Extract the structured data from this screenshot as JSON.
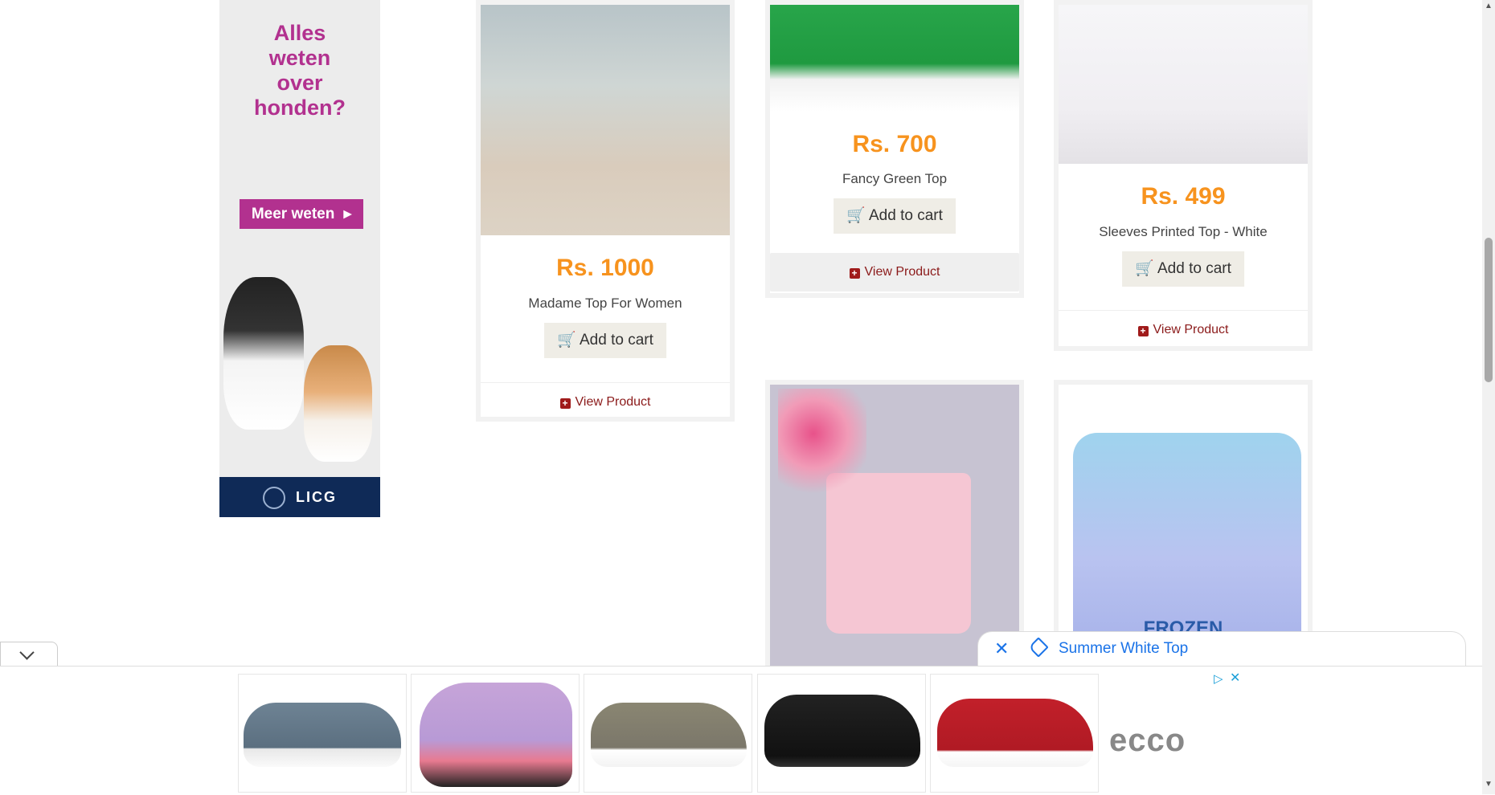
{
  "side_ad": {
    "headline_lines": [
      "Alles",
      "weten",
      "over",
      "honden?"
    ],
    "cta_label": "Meer weten",
    "brand": "LICG"
  },
  "products": [
    {
      "price": "Rs. 1000",
      "name": "Madame Top For Women",
      "cart_label": "Add to cart",
      "view_label": "View Product"
    },
    {
      "price": "Rs. 700",
      "name": "Fancy Green Top",
      "cart_label": "Add to cart",
      "view_label": "View Product"
    },
    {
      "price": "Rs. 499",
      "name": "Sleeves Printed Top - White",
      "cart_label": "Add to cart",
      "view_label": "View Product"
    }
  ],
  "frozen_shirt_text": "FROZEN",
  "search_chip": {
    "text": "Summer White Top"
  },
  "bottom_ad": {
    "brand": "ecco"
  },
  "colors": {
    "price": "#f7931e",
    "link": "#8b1a1a",
    "chip_link": "#1a73e8",
    "ad_accent": "#b2318f"
  }
}
